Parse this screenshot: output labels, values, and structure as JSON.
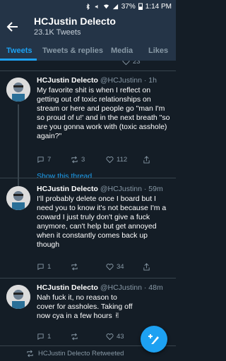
{
  "status": {
    "battery": "37%",
    "time": "1:14 PM"
  },
  "header": {
    "title": "HCJustin Delecto",
    "subtitle": "23.1K Tweets"
  },
  "tabs": [
    {
      "label": "Tweets"
    },
    {
      "label": "Tweets & replies"
    },
    {
      "label": "Media"
    },
    {
      "label": "Likes"
    }
  ],
  "prev_tweet": {
    "likes": "23"
  },
  "tweets": [
    {
      "name": "HCJustin Delecto",
      "handle": "@HCJustinn",
      "time": "· 1h",
      "text": "My favorite shit is when I reflect on getting out of toxic relationships on stream or here and people go \"man I'm so proud of u!' and in the next breath \"so are you gonna work with (toxic asshole) again?\"",
      "replies": "7",
      "retweets": "3",
      "likes": "112",
      "show_thread": "Show this thread"
    },
    {
      "name": "HCJustin Delecto",
      "handle": "@HCJustinn",
      "time": "· 59m",
      "text": "I'll probably delete once I board but I need you to know it's not because I'm a coward I just truly don't give a fuck anymore, can't help but get annoyed when it constantly comes back up though",
      "replies": "1",
      "retweets": "",
      "likes": "34"
    },
    {
      "name": "HCJustin Delecto",
      "handle": "@HCJustinn",
      "time": "· 48m",
      "text": "Nah fuck it, no reason to cover for assholes. Taking off now cya in a few hours ✌",
      "replies": "1",
      "retweets": "",
      "likes": "43"
    }
  ],
  "retweeted_label": "HCJustin Delecto Retweeted",
  "fab_icon": "compose-tweet-icon"
}
